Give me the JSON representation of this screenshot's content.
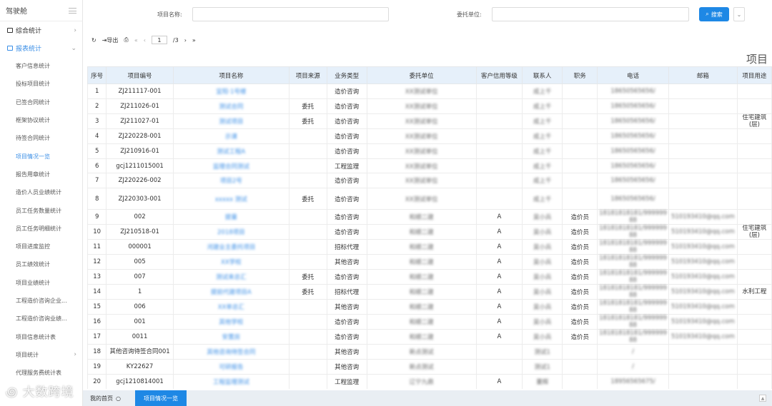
{
  "sidebar": {
    "title": "驾驶舱",
    "groups": [
      {
        "label": "综合统计"
      },
      {
        "label": "报表统计"
      }
    ],
    "items": [
      "客户信息统计",
      "投标项目统计",
      "已签合同统计",
      "框架协议统计",
      "待签合同统计",
      "项目情况一览",
      "报告用章统计",
      "造价人员业绩统计",
      "员工任务数量统计",
      "员工任务明细统计",
      "项目进度监控",
      "员工绩效统计",
      "项目业绩统计",
      "工程造价咨询企业...",
      "工程造价咨询业绩...",
      "项目信息统计表",
      "项目统计",
      "代理服务费统计表"
    ]
  },
  "search": {
    "name_label": "项目名称:",
    "client_label": "委托单位:",
    "search_btn": "搜索"
  },
  "toolbar": {
    "export": "导出",
    "page": "1",
    "total": "/3"
  },
  "section_title": "项目",
  "columns": [
    "序号",
    "项目编号",
    "项目名称",
    "项目来源",
    "业务类型",
    "委托单位",
    "客户信用等级",
    "联系人",
    "职务",
    "电话",
    "邮箱",
    "项目用途"
  ],
  "rows": [
    [
      "1",
      "ZJ211117-001",
      "宜阳·1号楼",
      "",
      "造价咨询",
      "XX测试单位",
      "",
      "成上千",
      "",
      "18650565656/",
      "",
      ""
    ],
    [
      "2",
      "ZJ211026-01",
      "测试合同",
      "委托",
      "造价咨询",
      "XX测试单位",
      "",
      "成上千",
      "",
      "18650565656/",
      "",
      ""
    ],
    [
      "3",
      "ZJ211027-01",
      "测试项目",
      "委托",
      "造价咨询",
      "XX测试单位",
      "",
      "成上千",
      "",
      "18650565656/",
      "",
      "住宅建筑(层)"
    ],
    [
      "4",
      "ZJ220228-001",
      "示课",
      "",
      "造价咨询",
      "XX测试单位",
      "",
      "成上千",
      "",
      "18650565656/",
      "",
      ""
    ],
    [
      "5",
      "ZJ210916-01",
      "测试工程A",
      "",
      "造价咨询",
      "XX测试单位",
      "",
      "成上千",
      "",
      "18650565656/",
      "",
      ""
    ],
    [
      "6",
      "gcj1211015001",
      "监理合同测试",
      "",
      "工程监理",
      "XX测试单位",
      "",
      "成上千",
      "",
      "18650565656/",
      "",
      ""
    ],
    [
      "7",
      "ZJ220226-002",
      "项目2号",
      "",
      "造价咨询",
      "XX测试单位",
      "",
      "成上千",
      "",
      "18650565656/",
      "",
      ""
    ],
    [
      "8",
      "ZJ220303-001",
      "xxxxx 测试",
      "委托",
      "造价咨询",
      "XX测试单位",
      "",
      "成上千",
      "",
      "18650565656/",
      "",
      ""
    ],
    [
      "9",
      "002",
      "提量",
      "",
      "造价咨询",
      "和顺二建",
      "A",
      "吴小兵",
      "造价员",
      "18181818181/999999 88",
      "510193410@qq.com",
      ""
    ],
    [
      "10",
      "ZJ210518-01",
      "2018项目",
      "",
      "造价咨询",
      "和顺二建",
      "A",
      "吴小兵",
      "造价员",
      "18181818181/999999 88",
      "510193410@qq.com",
      "住宅建筑(层)"
    ],
    [
      "11",
      "000001",
      "河建业主委托项目",
      "",
      "招标代理",
      "和顺二建",
      "A",
      "吴小兵",
      "造价员",
      "18181818181/999999 88",
      "510193410@qq.com",
      ""
    ],
    [
      "12",
      "005",
      "XX学校",
      "",
      "其他咨询",
      "和顺二建",
      "A",
      "吴小兵",
      "造价员",
      "18181818181/999999 88",
      "510193410@qq.com",
      ""
    ],
    [
      "13",
      "007",
      "测试来总汇",
      "委托",
      "造价咨询",
      "和顺二建",
      "A",
      "吴小兵",
      "造价员",
      "18181818181/999999 88",
      "510193410@qq.com",
      ""
    ],
    [
      "14",
      "1",
      "提前代建项目A",
      "委托",
      "招标代理",
      "和顺二建",
      "A",
      "吴小兵",
      "造价员",
      "18181818181/999999 88",
      "510193410@qq.com",
      "水利工程"
    ],
    [
      "15",
      "006",
      "XX单总汇",
      "",
      "其他咨询",
      "和顺二建",
      "A",
      "吴小兵",
      "造价员",
      "18181818181/999999 88",
      "510193410@qq.com",
      ""
    ],
    [
      "16",
      "001",
      "其他学校",
      "",
      "造价咨询",
      "和顺二建",
      "A",
      "吴小兵",
      "造价员",
      "18181818181/999999 88",
      "510193410@qq.com",
      ""
    ],
    [
      "17",
      "0011",
      "安置房",
      "",
      "造价咨询",
      "和顺二建",
      "A",
      "吴小兵",
      "造价员",
      "18181818181/999999 88",
      "510193410@qq.com",
      ""
    ],
    [
      "18",
      "其他咨询待签合同001",
      "其他咨询待签合同",
      "",
      "其他咨询",
      "新点测试",
      "",
      "测试1",
      "",
      "/",
      "",
      ""
    ],
    [
      "19",
      "KY22627",
      "可研报告",
      "",
      "其他咨询",
      "新点测试",
      "",
      "测试1",
      "",
      "/",
      "",
      ""
    ],
    [
      "20",
      "gcj1210814001",
      "工程监理测试",
      "",
      "工程监理",
      "辽宁九鼎",
      "A",
      "董辉",
      "",
      "18956565675/",
      "",
      ""
    ]
  ],
  "footer": {
    "home": "我的首页",
    "tab": "项目情况一览"
  },
  "watermark": "大数跨境"
}
